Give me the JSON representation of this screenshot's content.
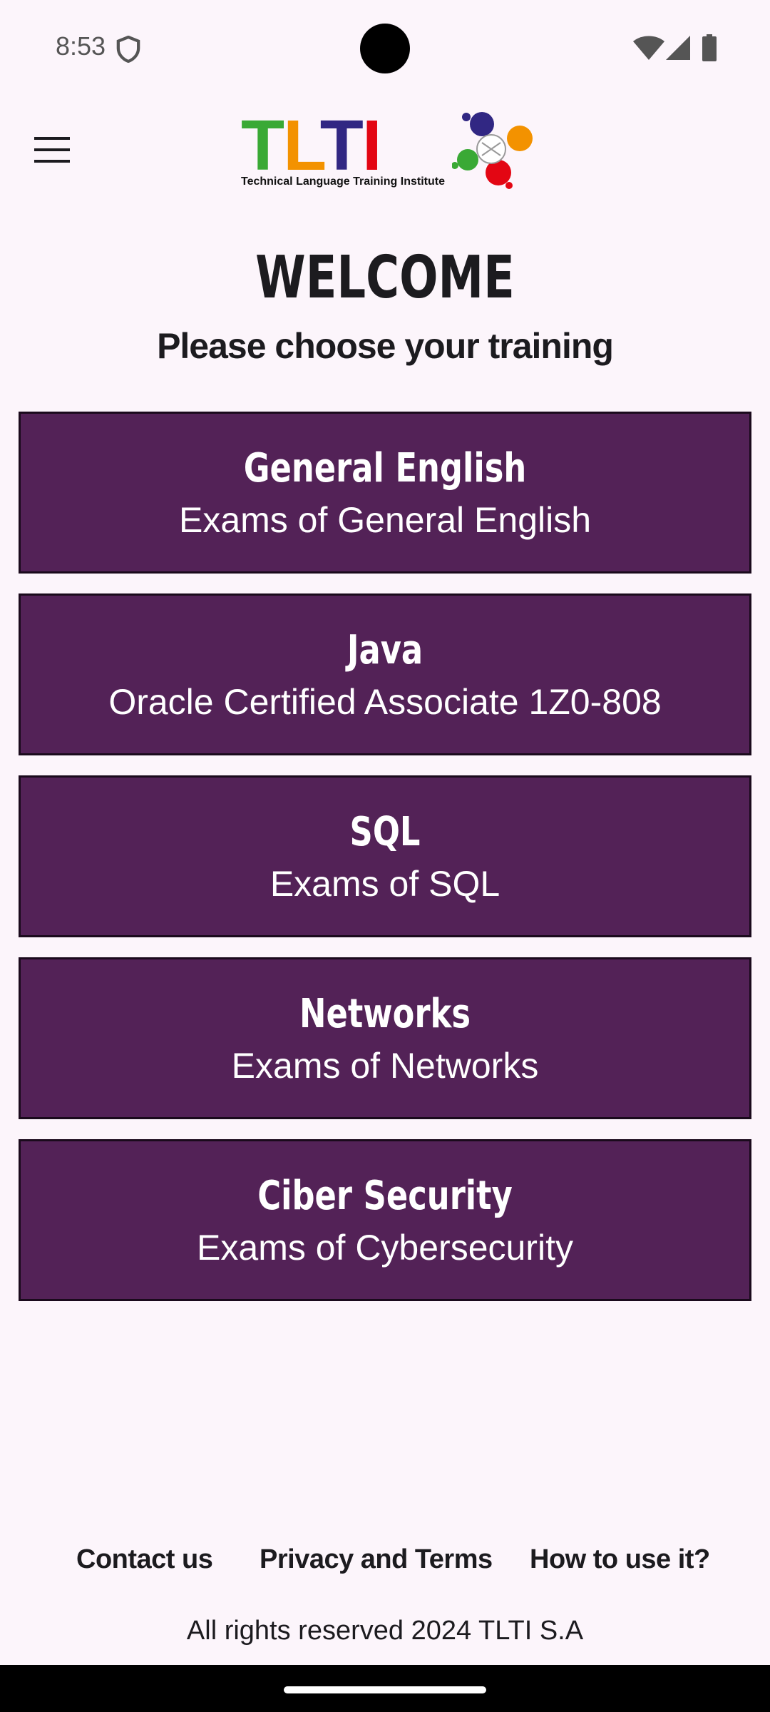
{
  "status_bar": {
    "time": "8:53",
    "icons": [
      "shield-icon",
      "wifi-icon",
      "signal-icon",
      "battery-icon"
    ]
  },
  "header": {
    "menu_icon": "hamburger-menu-icon",
    "logo": {
      "letters": [
        {
          "char": "T",
          "color": "#3aa935"
        },
        {
          "char": "L",
          "color": "#f39200"
        },
        {
          "char": "T",
          "color": "#312783"
        },
        {
          "char": "I",
          "color": "#e30613"
        }
      ],
      "tagline": "Technical Language Training Institute"
    }
  },
  "main": {
    "welcome": "WELCOME",
    "subtitle": "Please choose your training",
    "courses": [
      {
        "title": "General English",
        "description": "Exams of General English"
      },
      {
        "title": "Java",
        "description": "Oracle Certified Associate 1Z0-808"
      },
      {
        "title": "SQL",
        "description": "Exams of SQL"
      },
      {
        "title": "Networks",
        "description": "Exams of Networks"
      },
      {
        "title": "Ciber Security",
        "description": "Exams of Cybersecurity"
      }
    ]
  },
  "footer": {
    "links": [
      "Contact us",
      "Privacy and Terms",
      "How to use it?"
    ],
    "copyright": "All rights reserved 2024 TLTI S.A"
  },
  "colors": {
    "background": "#fcf5fb",
    "card_background": "#532257",
    "card_text": "#ffffff",
    "text": "#1c1b1f"
  }
}
